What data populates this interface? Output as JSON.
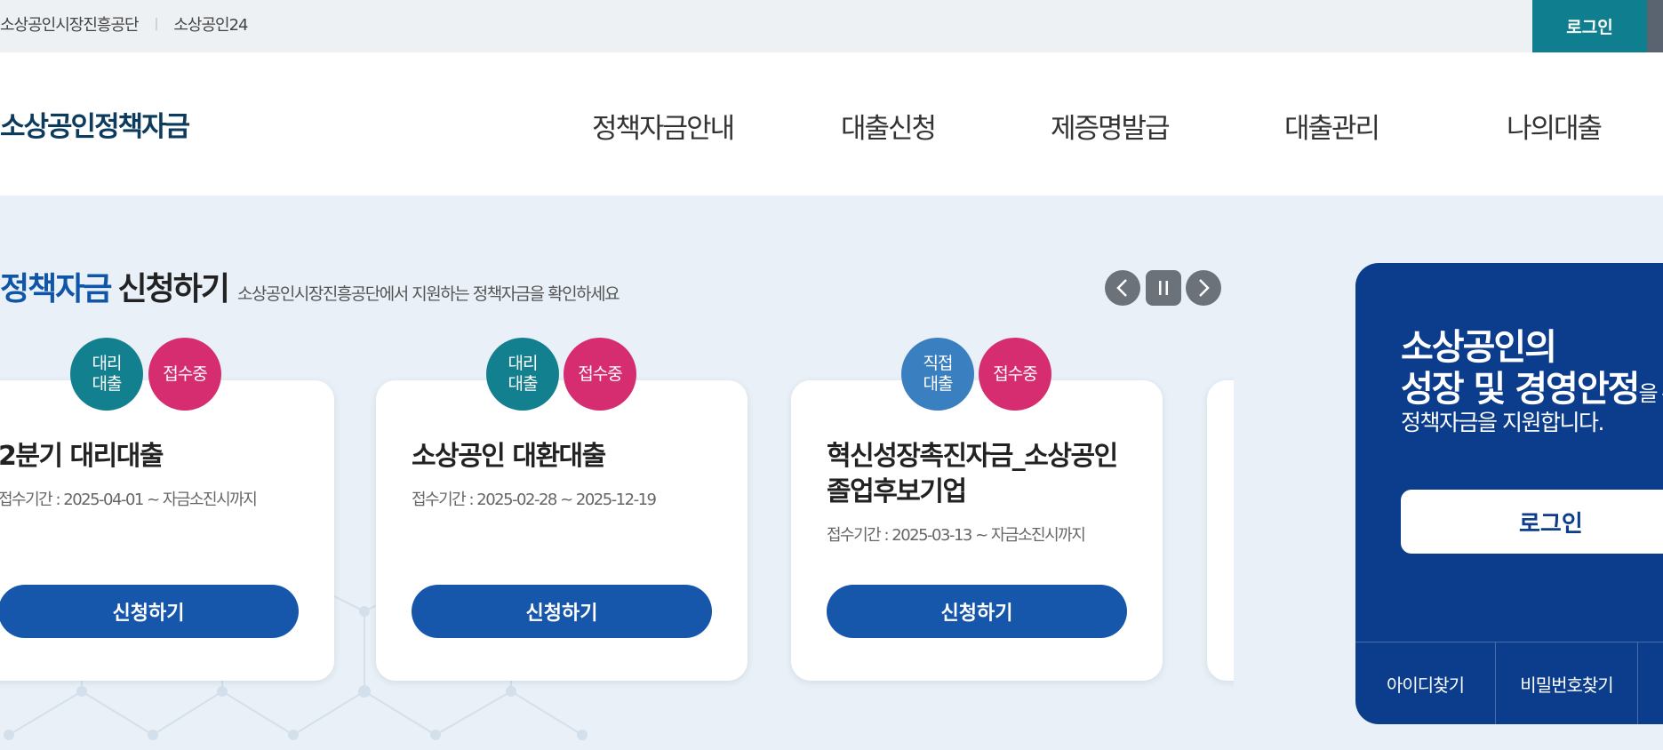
{
  "utility": {
    "links": [
      "소상공인시장진흥공단",
      "소상공인24"
    ],
    "separator": "|",
    "login_label": "로그인"
  },
  "header": {
    "logo": "소상공인정책자금",
    "nav": [
      "정책자금안내",
      "대출신청",
      "제증명발급",
      "대출관리",
      "나의대출"
    ]
  },
  "section": {
    "title_accent": "정책자금",
    "title_rest": "신청하기",
    "description": "소상공인시장진흥공단에서 지원하는 정책자금을 확인하세요",
    "controls": {
      "prev_icon": "chevron-left-icon",
      "pause_icon": "pause-icon",
      "next_icon": "chevron-right-icon"
    }
  },
  "cards": [
    {
      "badge_type": "대리\n대출",
      "status": "접수중",
      "title": "2분기 대리대출",
      "period": "접수기간 : 2025-04-01 ~ 자금소진시까지",
      "button": "신청하기"
    },
    {
      "badge_type": "대리\n대출",
      "status": "접수중",
      "title": "소상공인 대환대출",
      "period": "접수기간 : 2025-02-28 ~ 2025-12-19",
      "button": "신청하기"
    },
    {
      "badge_type": "직접\n대출",
      "status": "접수중",
      "title": "혁신성장촉진자금_소상공인 졸업후보기업",
      "period": "접수기간 : 2025-03-13 ~ 자금소진시까지",
      "button": "신청하기"
    }
  ],
  "login_panel": {
    "line1": "소상공인의",
    "line2_bold": "성장 및 경영안정",
    "line2_rest": "을 위",
    "line3": "정책자금을 지원합니다.",
    "button": "로그인",
    "links": [
      "아이디찾기",
      "비밀번호찾기"
    ]
  },
  "colors": {
    "brand_teal": "#0f7e8e",
    "accent_blue": "#1656ab",
    "panel_navy": "#0b3d8c",
    "badge_pink": "#d52d70"
  }
}
